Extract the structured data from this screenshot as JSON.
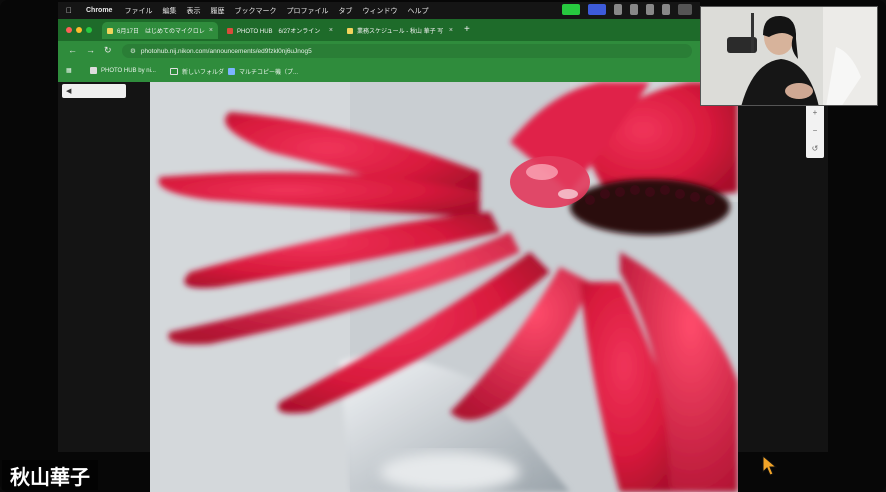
{
  "menubar": {
    "app": "Chrome",
    "items": [
      "ファイル",
      "編集",
      "表示",
      "履歴",
      "ブックマーク",
      "プロファイル",
      "タブ",
      "ウィンドウ",
      "ヘルプ"
    ]
  },
  "tabs": [
    {
      "label": "6月17日　はじめてのマイクロレ",
      "active": true
    },
    {
      "label": "PHOTO HUB　6/27オンライン",
      "active": false
    },
    {
      "label": "業務スケジュール - 秋山 華子 写",
      "active": false
    }
  ],
  "address_bar": {
    "url": "photohub.nij.nikon.com/announcements/ed9fzkl0nj6uJnog5"
  },
  "bookmarks": [
    {
      "label": "PHOTO HUB by ni..."
    },
    {
      "label": "新しいフォルダ"
    },
    {
      "label": "マルチコピー機（プ..."
    }
  ],
  "viewer": {
    "back_label": "◀"
  },
  "zoom": {
    "in": "+",
    "out": "−",
    "reset": "↺"
  },
  "participant": {
    "name": "秋山華子"
  },
  "colors": {
    "browser_accent": "#2f8c3c",
    "flower_red": "#d81a3c"
  }
}
